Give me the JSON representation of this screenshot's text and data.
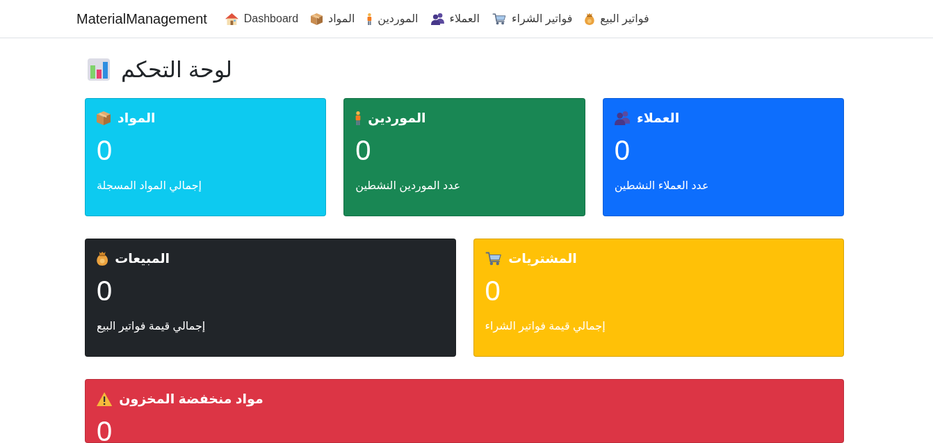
{
  "navbar": {
    "brand": "MaterialManagement",
    "links": [
      {
        "kind": "sales",
        "label": "فواتير البيع"
      },
      {
        "kind": "purchases",
        "label": "فواتير الشراء"
      },
      {
        "kind": "customers",
        "label": "العملاء"
      },
      {
        "kind": "suppliers",
        "label": "الموردين"
      },
      {
        "kind": "materials",
        "label": "المواد"
      },
      {
        "kind": "dashboard",
        "label": "Dashboard"
      }
    ]
  },
  "page": {
    "title": "لوحة التحكم"
  },
  "card_rows": [
    [
      {
        "kind": "customers",
        "title": "العملاء",
        "value": "0",
        "caption": "عدد العملاء النشطين",
        "color": "#0d6efd"
      },
      {
        "kind": "suppliers",
        "title": "الموردين",
        "value": "0",
        "caption": "عدد الموردين النشطين",
        "color": "#198754"
      },
      {
        "kind": "materials",
        "title": "المواد",
        "value": "0",
        "caption": "إجمالي المواد المسجلة",
        "color": "#0dcaf0"
      }
    ],
    [
      {
        "kind": "purchases",
        "title": "المشتريات",
        "value": "0",
        "caption": "إجمالي قيمة فواتير الشراء",
        "color": "#ffc107"
      },
      {
        "kind": "sales",
        "title": "المبيعات",
        "value": "0",
        "caption": "إجمالي قيمة فواتير البيع",
        "color": "#212529"
      }
    ],
    [
      {
        "kind": "low_stock",
        "title": "مواد منخفضة المخزون",
        "value": "0",
        "color": "#dc3545"
      }
    ]
  ]
}
